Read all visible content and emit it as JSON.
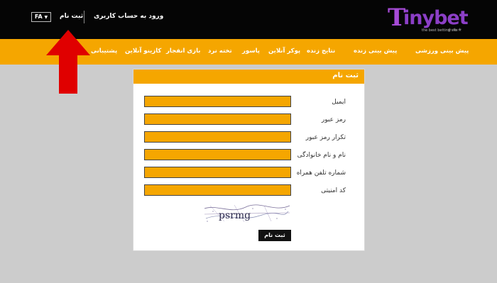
{
  "header": {
    "lang": "FA",
    "register": "ثبت نام",
    "login": "ورود به حساب کاربری",
    "logo_tagline": "the best betting site"
  },
  "nav": {
    "items": [
      "پیش بینی ورزشی",
      "پیش بینی زنده",
      "نتایج زنده",
      "پوکر آنلاین",
      "پاسور",
      "تخته نرد",
      "بازی انفجار",
      "کازینو آنلاین",
      "پشتیبانی"
    ]
  },
  "form": {
    "title": "ثبت نام",
    "labels": {
      "email": "ایمیل",
      "password": "رمز عبور",
      "password_repeat": "تکرار رمز عبور",
      "fullname": "نام و نام خانوادگی",
      "phone": "شماره تلفن همراه",
      "security_code": "کد امنیتی"
    },
    "captcha_text": "psrmg",
    "submit": "ثبت نام"
  },
  "colors": {
    "header_bg": "#050505",
    "accent": "#f5a600",
    "brand": "#8c3fc7",
    "arrow": "#e00000"
  }
}
